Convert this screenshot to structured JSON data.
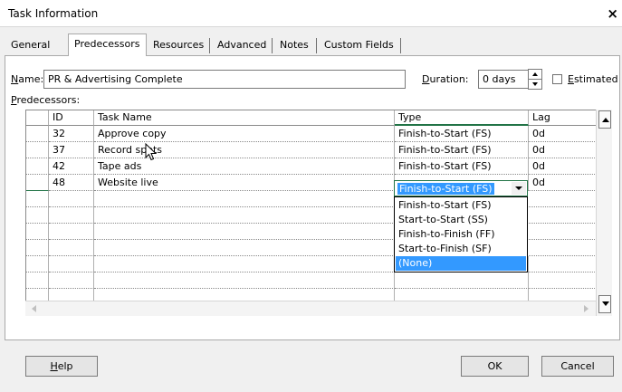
{
  "dialog": {
    "title": "Task Information",
    "close_glyph": "×"
  },
  "tabs": [
    {
      "label": "General",
      "active": false
    },
    {
      "label": "Predecessors",
      "active": true
    },
    {
      "label": "Resources",
      "active": false
    },
    {
      "label": "Advanced",
      "active": false
    },
    {
      "label": "Notes",
      "active": false
    },
    {
      "label": "Custom Fields",
      "active": false
    }
  ],
  "form": {
    "name_label_u": "N",
    "name_label_rest": "ame:",
    "name_value": "PR & Advertising Complete",
    "duration_label_u": "D",
    "duration_label_rest": "uration:",
    "duration_value": "0 days",
    "estimated_label_u": "E",
    "estimated_label_rest": "stimated",
    "estimated_checked": false,
    "predecessors_label_u": "P",
    "predecessors_label_rest": "redecessors:"
  },
  "grid": {
    "columns": [
      "ID",
      "Task Name",
      "Type",
      "Lag"
    ],
    "rows": [
      {
        "id": "32",
        "task": "Approve copy",
        "type": "Finish-to-Start (FS)",
        "lag": "0d"
      },
      {
        "id": "37",
        "task": "Record spots",
        "type": "Finish-to-Start (FS)",
        "lag": "0d"
      },
      {
        "id": "42",
        "task": "Tape ads",
        "type": "Finish-to-Start (FS)",
        "lag": "0d"
      },
      {
        "id": "48",
        "task": "Website live",
        "type": "Finish-to-Start (FS)",
        "lag": "0d"
      }
    ],
    "editing_row": 3
  },
  "type_dropdown": {
    "current_value": "Finish-to-Start (FS)",
    "options": [
      "Finish-to-Start (FS)",
      "Start-to-Start (SS)",
      "Finish-to-Finish (FF)",
      "Start-to-Finish (SF)",
      "(None)"
    ],
    "highlighted_option": "(None)"
  },
  "buttons": {
    "help_u": "H",
    "help_rest": "elp",
    "ok": "OK",
    "cancel": "Cancel"
  },
  "colors": {
    "accent_green": "#217346",
    "selection_blue": "#3399ff"
  },
  "icons": [
    "close-icon",
    "spin-up-icon",
    "spin-down-icon",
    "scroll-up-icon",
    "scroll-down-icon",
    "scroll-left-icon",
    "scroll-right-icon",
    "dropdown-arrow-icon",
    "mouse-cursor-icon"
  ]
}
